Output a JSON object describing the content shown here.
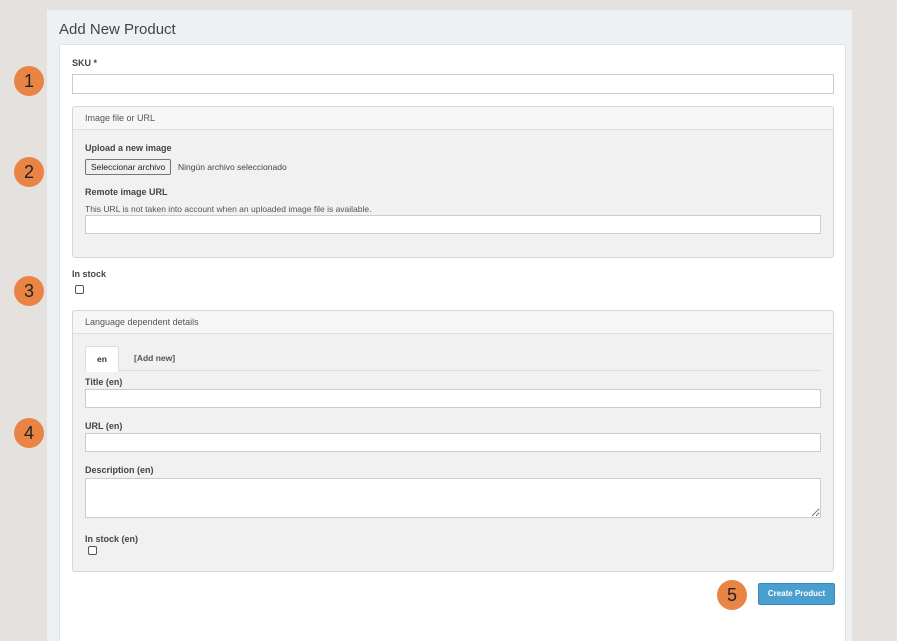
{
  "page": {
    "title": "Add New Product"
  },
  "form": {
    "sku_label": "SKU *",
    "sku_value": "",
    "image": {
      "heading": "Image file or URL",
      "upload_label": "Upload a new image",
      "file_button": "Seleccionar archivo",
      "file_status": "Ningún archivo seleccionado",
      "remote_label": "Remote image URL",
      "remote_help": "This URL is not taken into account when an uploaded image file is available.",
      "remote_value": ""
    },
    "in_stock_label": "In stock",
    "in_stock_checked": false,
    "language": {
      "heading": "Language dependent details",
      "tabs": [
        {
          "label": "en",
          "active": true
        },
        {
          "label": "[Add new]",
          "active": false
        }
      ],
      "title_label": "Title (en)",
      "url_label": "URL (en)",
      "description_label": "Description (en)",
      "in_stock_label": "In stock (en)",
      "in_stock_checked": false
    },
    "submit_label": "Create Product"
  },
  "markers": [
    "1",
    "2",
    "3",
    "4",
    "5"
  ],
  "colors": {
    "accent": "#4a9fd1",
    "marker": "#e98445",
    "background": "#e5e1df"
  }
}
